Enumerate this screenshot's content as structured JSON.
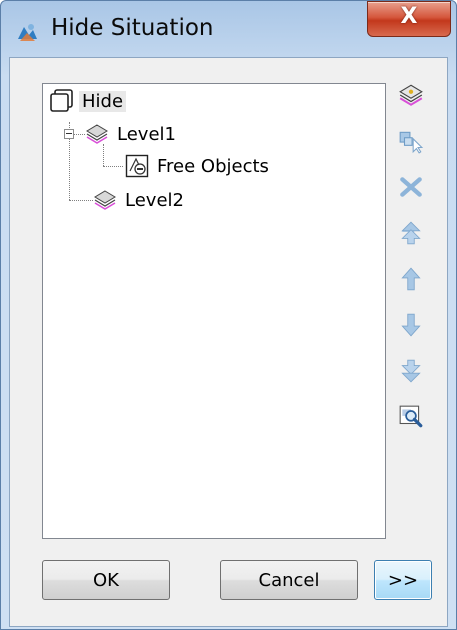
{
  "window": {
    "title": "Hide Situation",
    "close_label": "X"
  },
  "tree": {
    "root": {
      "label": "Hide",
      "icon": "frame-icon"
    },
    "children": [
      {
        "label": "Level1",
        "icon": "layer-icon",
        "expanded": true,
        "children": [
          {
            "label": "Free Objects",
            "icon": "free-objects-icon"
          }
        ]
      },
      {
        "label": "Level2",
        "icon": "layer-icon"
      }
    ]
  },
  "toolbar": {
    "buttons": [
      {
        "name": "add-level",
        "icon": "add-layer-icon",
        "enabled": true
      },
      {
        "name": "select-objects",
        "icon": "select-cursor-icon",
        "enabled": false
      },
      {
        "name": "delete",
        "icon": "delete-x-icon",
        "enabled": false
      },
      {
        "name": "move-top",
        "icon": "double-up-arrow-icon",
        "enabled": false
      },
      {
        "name": "move-up",
        "icon": "up-arrow-icon",
        "enabled": false
      },
      {
        "name": "move-down",
        "icon": "down-arrow-icon",
        "enabled": false
      },
      {
        "name": "move-bottom",
        "icon": "double-down-arrow-icon",
        "enabled": false
      },
      {
        "name": "zoom",
        "icon": "magnifier-icon",
        "enabled": true
      }
    ]
  },
  "footer": {
    "ok_label": "OK",
    "cancel_label": "Cancel",
    "expand_label": ">>"
  },
  "colors": {
    "accent": "#3c7fb1",
    "close": "#c3381c",
    "disabled_icon": "#9fc0dd"
  }
}
